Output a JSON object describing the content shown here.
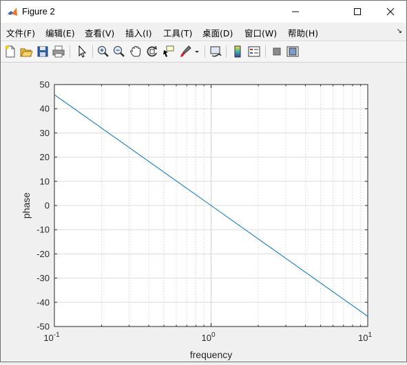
{
  "window": {
    "title": "Figure 2",
    "minimize_icon": "minimize-icon",
    "maximize_icon": "maximize-icon",
    "close_icon": "close-icon"
  },
  "menubar": {
    "items": [
      {
        "label": "文件(F)"
      },
      {
        "label": "编辑(E)"
      },
      {
        "label": "查看(V)"
      },
      {
        "label": "插入(I)"
      },
      {
        "label": "工具(T)"
      },
      {
        "label": "桌面(D)"
      },
      {
        "label": "窗口(W)"
      },
      {
        "label": "帮助(H)"
      }
    ],
    "dock_arrow": "↘"
  },
  "toolbar": {
    "icons": [
      "new-figure-icon",
      "open-file-icon",
      "save-icon",
      "print-icon",
      "edit-plot-icon",
      "zoom-in-icon",
      "zoom-out-icon",
      "pan-icon",
      "rotate-3d-icon",
      "data-cursor-icon",
      "brush-icon",
      "brush-dropdown-icon",
      "link-plot-icon",
      "insert-colorbar-icon",
      "insert-legend-icon",
      "hide-plot-tools-icon",
      "show-plot-tools-icon"
    ]
  },
  "chart_data": {
    "type": "line",
    "xscale": "log",
    "xlim": [
      0.1,
      10
    ],
    "ylim": [
      -50,
      50
    ],
    "xlabel": "frequency",
    "ylabel": "phase",
    "yticks": [
      "50",
      "40",
      "30",
      "20",
      "10",
      "0",
      "-10",
      "-20",
      "-30",
      "-40",
      "-50"
    ],
    "xticks": [
      {
        "base": "10",
        "exp": "-1"
      },
      {
        "base": "10",
        "exp": "0"
      },
      {
        "base": "10",
        "exp": "1"
      }
    ],
    "grid": true,
    "series": [
      {
        "color": "#0072bd",
        "x": [
          0.1,
          1,
          10
        ],
        "y": [
          45.8,
          0,
          -45.8
        ]
      }
    ]
  }
}
